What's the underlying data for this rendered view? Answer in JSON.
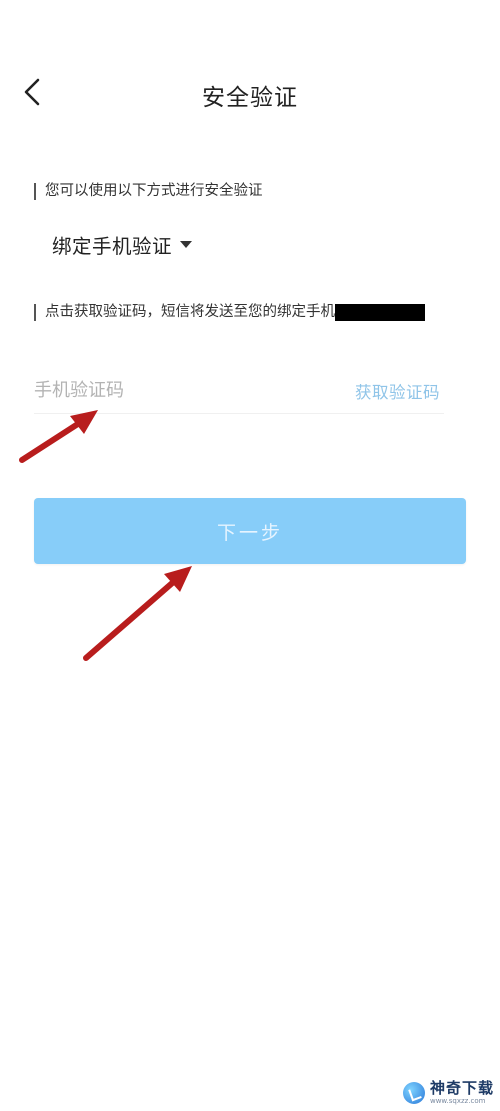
{
  "header": {
    "title": "安全验证",
    "back_icon": "chevron-left-icon"
  },
  "verify": {
    "hint": "您可以使用以下方式进行安全验证",
    "method": "绑定手机验证",
    "method_icon": "caret-down-icon"
  },
  "sms": {
    "hint": "点击获取验证码，短信将发送至您的绑定手机",
    "code_placeholder": "手机验证码",
    "get_code_label": "获取验证码"
  },
  "actions": {
    "next_label": "下一步"
  },
  "annotation": {
    "arrow_color": "#b81d1d"
  },
  "colors": {
    "button_bg": "#87cdf9",
    "link": "#8fc4e8"
  },
  "watermark": {
    "name": "神奇下载",
    "url": "www.sqxzz.com"
  }
}
